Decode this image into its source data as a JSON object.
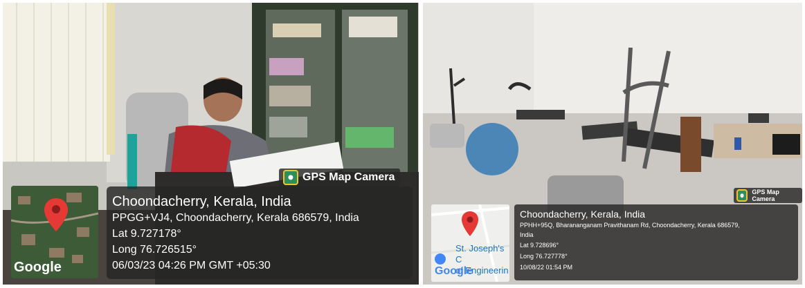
{
  "left": {
    "badge_label": "GPS Map Camera",
    "location_title": "Choondacherry, Kerala, India",
    "address": "PPGG+VJ4, Choondacherry, Kerala 686579, India",
    "lat": "Lat 9.727178°",
    "long": "Long 76.726515°",
    "datetime": "06/03/23 04:26 PM GMT +05:30",
    "map_logo": "Google"
  },
  "right": {
    "badge_label": "GPS Map Camera",
    "location_title": "Choondacherry, Kerala, India",
    "address_line1": "PPHH+95Q, Bharananganam Pravithanam Rd, Choondacherry, Kerala 686579,",
    "address_line2": "India",
    "lat": "Lat 9.728696°",
    "long": "Long 76.727778°",
    "datetime": "10/08/22 01:54 PM",
    "map_label_line1": "St. Joseph's C",
    "map_label_line2": "of Engineerin",
    "map_logo": "Google"
  },
  "colors": {
    "badge_icon": "#2f8f5b",
    "overlay": "#262626",
    "map_pin": "#e53935"
  }
}
